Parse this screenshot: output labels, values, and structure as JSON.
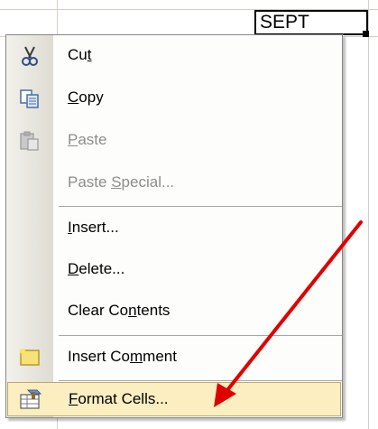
{
  "cell": {
    "value": "SEPT"
  },
  "menu": {
    "items": [
      {
        "pre": "Cu",
        "key": "t",
        "post": "",
        "icon": "scissors-icon",
        "disabled": false
      },
      {
        "pre": "",
        "key": "C",
        "post": "opy",
        "icon": "copy-icon",
        "disabled": false
      },
      {
        "pre": "",
        "key": "P",
        "post": "aste",
        "icon": "paste-icon",
        "disabled": true
      },
      {
        "pre": "Paste ",
        "key": "S",
        "post": "pecial...",
        "icon": "",
        "disabled": true
      },
      {
        "pre": "",
        "key": "I",
        "post": "nsert...",
        "icon": "",
        "disabled": false
      },
      {
        "pre": "",
        "key": "D",
        "post": "elete...",
        "icon": "",
        "disabled": false
      },
      {
        "pre": "Clear Co",
        "key": "n",
        "post": "tents",
        "icon": "",
        "disabled": false
      },
      {
        "pre": "Insert Co",
        "key": "m",
        "post": "ment",
        "icon": "comment-icon",
        "disabled": false
      },
      {
        "pre": "",
        "key": "F",
        "post": "ormat Cells...",
        "icon": "format-cells-icon",
        "disabled": false
      }
    ]
  },
  "colors": {
    "highlight": "#fbeec1",
    "arrow": "#e00000"
  }
}
